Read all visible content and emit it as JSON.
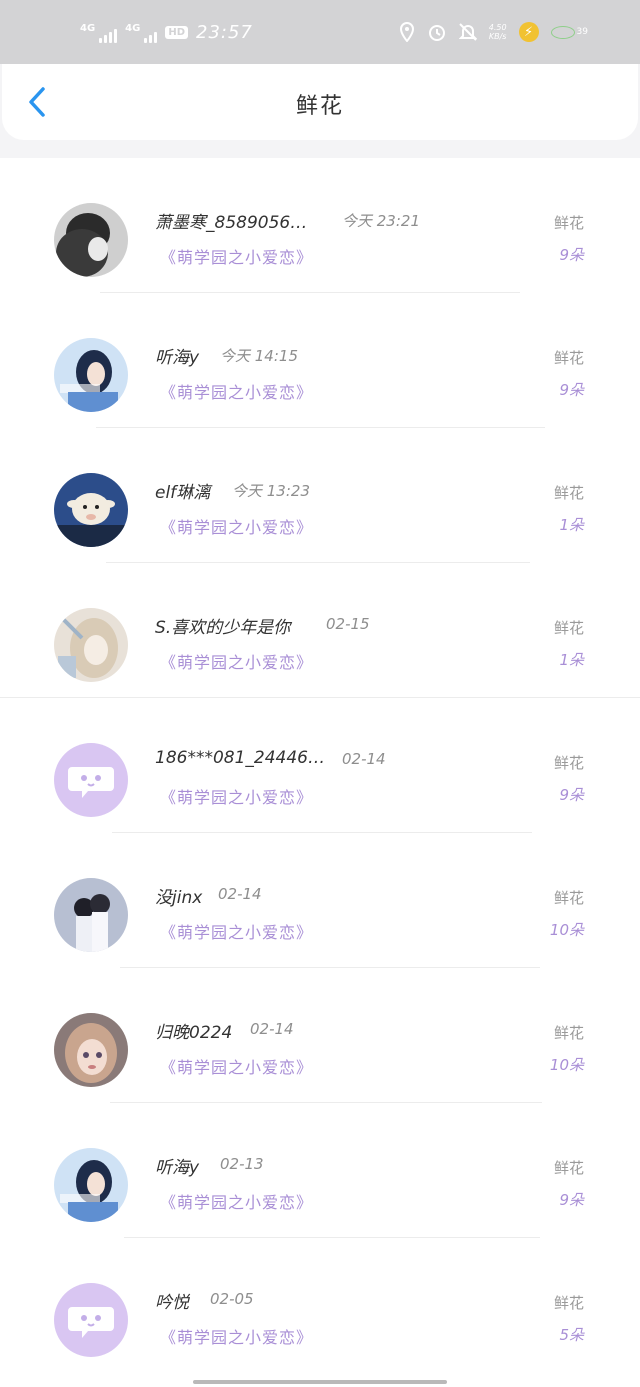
{
  "status_bar": {
    "signal1": "4G",
    "signal2": "4G",
    "hd": "HD",
    "time": "23:57",
    "speed_top": "4.50",
    "speed_bottom": "KB/s",
    "battery": "39"
  },
  "header": {
    "title": "鲜花"
  },
  "colors": {
    "accent": "#a98fd6",
    "back": "#2a95ef",
    "default_avatar": "#d9c6f2"
  },
  "records": [
    {
      "name": "萧墨寒_8589056…",
      "time": "今天 23:21",
      "book": "《萌学园之小爱恋》",
      "type": "鲜花",
      "count": "9朵",
      "avatar": "photo-dark"
    },
    {
      "name": "听海y",
      "time": "今天 14:15",
      "book": "《萌学园之小爱恋》",
      "type": "鲜花",
      "count": "9朵",
      "avatar": "photo-blue-girl"
    },
    {
      "name": "elf琳漓",
      "time": "今天 13:23",
      "book": "《萌学园之小爱恋》",
      "type": "鲜花",
      "count": "1朵",
      "avatar": "photo-sheep"
    },
    {
      "name": "S.喜欢的少年是你",
      "time": "02-15",
      "book": "《萌学园之小爱恋》",
      "type": "鲜花",
      "count": "1朵",
      "avatar": "photo-anime-pale"
    },
    {
      "name": "186***081_24446…",
      "time": "02-14",
      "book": "《萌学园之小爱恋》",
      "type": "鲜花",
      "count": "9朵",
      "avatar": "default"
    },
    {
      "name": "没jinx",
      "time": "02-14",
      "book": "《萌学园之小爱恋》",
      "type": "鲜花",
      "count": "10朵",
      "avatar": "photo-couple"
    },
    {
      "name": "归晚0224",
      "time": "02-14",
      "book": "《萌学园之小爱恋》",
      "type": "鲜花",
      "count": "10朵",
      "avatar": "photo-anime-brown"
    },
    {
      "name": "听海y",
      "time": "02-13",
      "book": "《萌学园之小爱恋》",
      "type": "鲜花",
      "count": "9朵",
      "avatar": "photo-blue-girl"
    },
    {
      "name": "吟悦",
      "time": "02-05",
      "book": "《萌学园之小爱恋》",
      "type": "鲜花",
      "count": "5朵",
      "avatar": "default"
    }
  ]
}
